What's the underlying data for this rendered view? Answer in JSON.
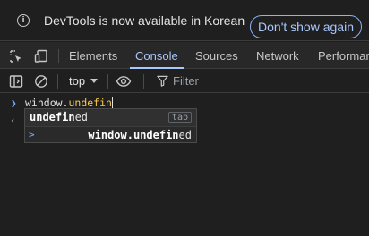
{
  "banner": {
    "message": "DevTools is now available in Korean",
    "dismiss_label": "Don't show again",
    "icon": "info-icon"
  },
  "tabs": [
    {
      "label": "Elements",
      "active": false
    },
    {
      "label": "Console",
      "active": true
    },
    {
      "label": "Sources",
      "active": false
    },
    {
      "label": "Network",
      "active": false
    },
    {
      "label": "Performar",
      "active": false
    }
  ],
  "toolbar_icons": [
    "inspect-element-icon",
    "device-toolbar-icon"
  ],
  "console_toolbar": {
    "context": "top",
    "filter_placeholder": "Filter",
    "icons": [
      "sidebar-toggle-icon",
      "clear-console-icon",
      "eye-icon",
      "filter-icon"
    ]
  },
  "console": {
    "input_object": "window.",
    "input_property": "undefin",
    "autocomplete": {
      "suggestion_typed": "undefin",
      "suggestion_rest": "ed",
      "key_hint": "tab",
      "preview_typed": "window.undefin",
      "preview_rest": "ed"
    }
  },
  "colors": {
    "accent": "#a8c7fa",
    "background": "#1f1f1f",
    "property": "#f9c74f"
  }
}
